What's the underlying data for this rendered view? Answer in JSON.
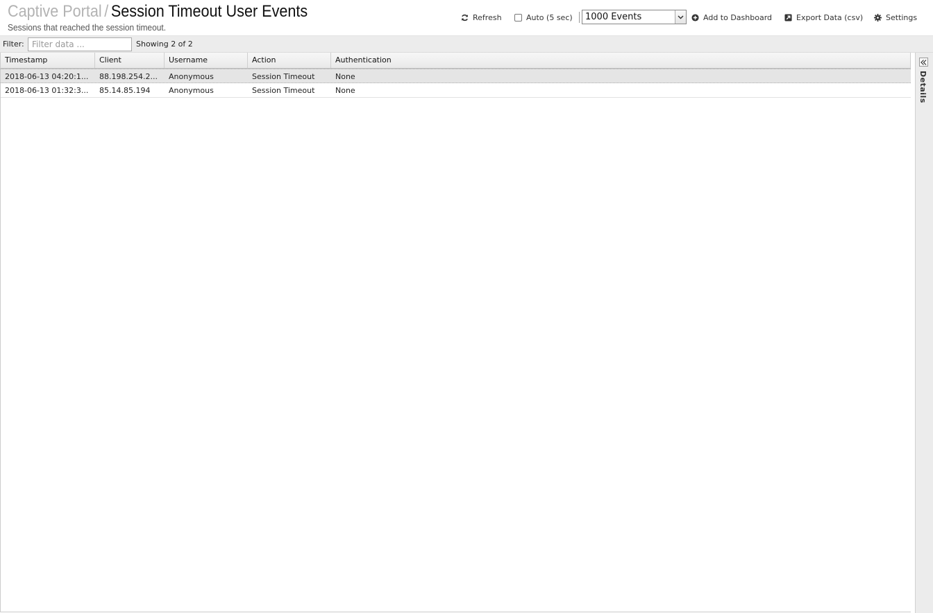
{
  "header": {
    "breadcrumb": "Captive Portal",
    "breadcrumb_sep": "/",
    "title": "Session Timeout User Events",
    "subtitle": "Sessions that reached the session timeout."
  },
  "toolbar": {
    "refresh_label": "Refresh",
    "auto_label": "Auto (5 sec)",
    "auto_checked": false,
    "events_selected": "1000 Events",
    "add_dashboard_label": "Add to Dashboard",
    "export_label": "Export Data (csv)",
    "settings_label": "Settings"
  },
  "filter": {
    "label": "Filter:",
    "placeholder": "Filter data ...",
    "value": "",
    "showing": "Showing 2 of 2"
  },
  "grid": {
    "columns": [
      "Timestamp",
      "Client",
      "Username",
      "Action",
      "Authentication"
    ],
    "rows": [
      [
        "2018-06-13 04:20:1...",
        "88.198.254.2...",
        "Anonymous",
        "Session Timeout",
        "None"
      ],
      [
        "2018-06-13 01:32:3...",
        "85.14.85.194",
        "Anonymous",
        "Session Timeout",
        "None"
      ]
    ],
    "selected_row": 0
  },
  "details_panel": {
    "label": "Details"
  },
  "colors": {
    "breadcrumb": "#b3b3b3",
    "header_bg": "#ffffff",
    "filterbar_bg": "#ececec",
    "selected_row_bg": "#e5e5e5"
  }
}
